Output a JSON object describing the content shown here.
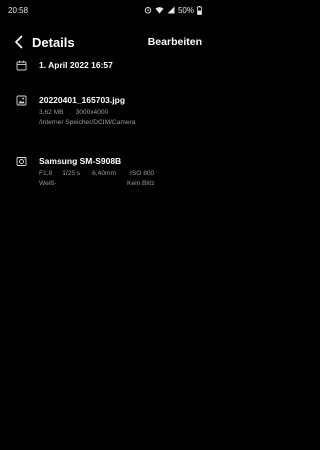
{
  "status_bar": {
    "time": "20:58",
    "battery": "50%",
    "icons": [
      "alarm-icon",
      "wifi-icon",
      "signal-icon",
      "battery-icon"
    ]
  },
  "app_bar": {
    "back_icon": "chevron-left-icon",
    "title": "Details",
    "edit_label": "Bearbeiten"
  },
  "date": {
    "icon": "calendar-icon",
    "value": "1. April 2022 16:57"
  },
  "file": {
    "icon": "image-icon",
    "name": "20220401_165703.jpg",
    "size": "3,62 MB",
    "resolution": "3000x4000",
    "path": "/Interner Speicher/DCIM/Camera"
  },
  "camera": {
    "icon": "camera-icon",
    "model": "Samsung SM-S908B",
    "aperture": "F1,8",
    "exposure": "1/25 s",
    "focal_length": "6,40mm",
    "iso": "ISO 800",
    "white_balance": "Weiß-",
    "flash": "Kein Blitz"
  },
  "colors": {
    "background": "#000000",
    "primary_text": "#ffffff",
    "secondary_text": "#9a9a9a"
  }
}
